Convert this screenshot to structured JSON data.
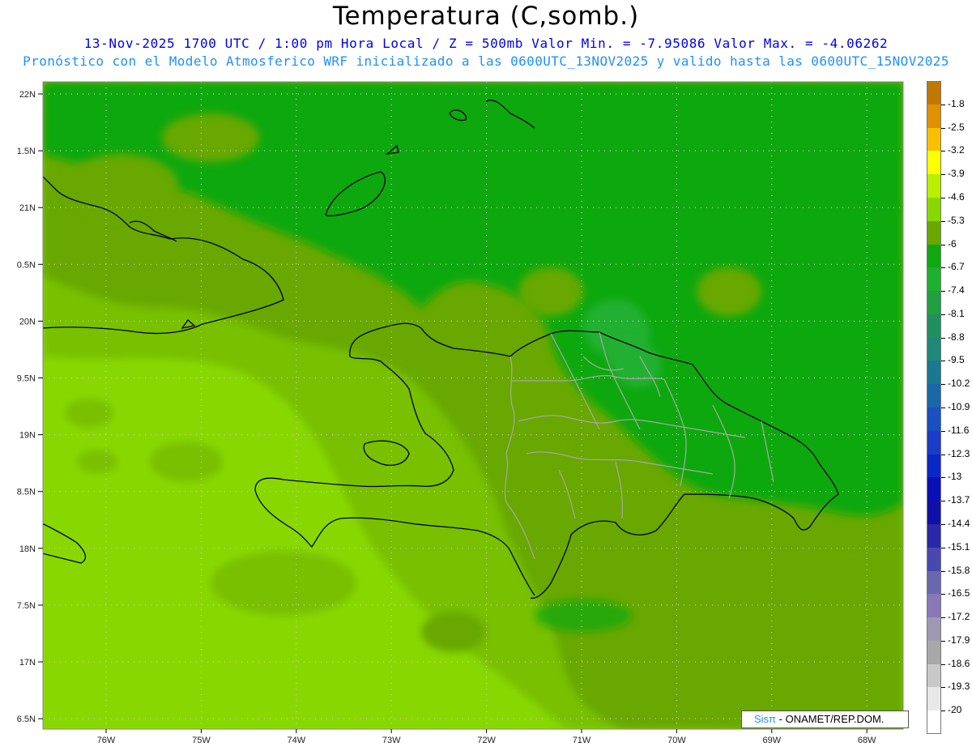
{
  "title": "Temperatura (C,somb.)",
  "subtitle_line1": "13-Nov-2025  1700 UTC / 1:00 pm Hora Local / Z = 500mb  Valor Min. = -7.95086  Valor Max. = -4.06262",
  "subtitle_line2": "Pronóstico con el Modelo Atmosferico WRF inicializado a las 0600UTC_13NOV2025 y valido hasta las  0600UTC_15NOV2025",
  "lat_labels": [
    "22N",
    "1.5N",
    "21N",
    "0.5N",
    "20N",
    "9.5N",
    "19N",
    "8.5N",
    "18N",
    "7.5N",
    "17N",
    "6.5N"
  ],
  "lon_labels": [
    "76W",
    "75W",
    "74W",
    "73W",
    "72W",
    "71W",
    "70W",
    "69W",
    "68W"
  ],
  "colorbar": {
    "labels": [
      "-1.8",
      "-2.5",
      "-3.2",
      "-3.9",
      "-4.6",
      "-5.3",
      "-6",
      "-6.7",
      "-7.4",
      "-8.1",
      "-8.8",
      "-9.5",
      "-10.2",
      "-10.9",
      "-11.6",
      "-12.3",
      "-13",
      "-13.7",
      "-14.4",
      "-15.1",
      "-15.8",
      "-16.5",
      "-17.2",
      "-17.9",
      "-18.6",
      "-19.3",
      "-20"
    ],
    "colors": [
      "#c07800",
      "#e09000",
      "#f8c000",
      "#ffff00",
      "#b8f000",
      "#88d800",
      "#68a800",
      "#10a810",
      "#20b030",
      "#20a040",
      "#209060",
      "#208878",
      "#1a7890",
      "#1a68a8",
      "#1a50c0",
      "#1a3cc8",
      "#0a28c8",
      "#0a10b8",
      "#1010a8",
      "#2828a8",
      "#4848b0",
      "#6868b0",
      "#8878b8",
      "#a098b0",
      "#a8a8a8",
      "#c8c8c8",
      "#e8e8e8",
      "#ffffff"
    ]
  },
  "credit": {
    "brand": "Sisπ",
    "org": " - ONAMET/REP.DOM."
  }
}
